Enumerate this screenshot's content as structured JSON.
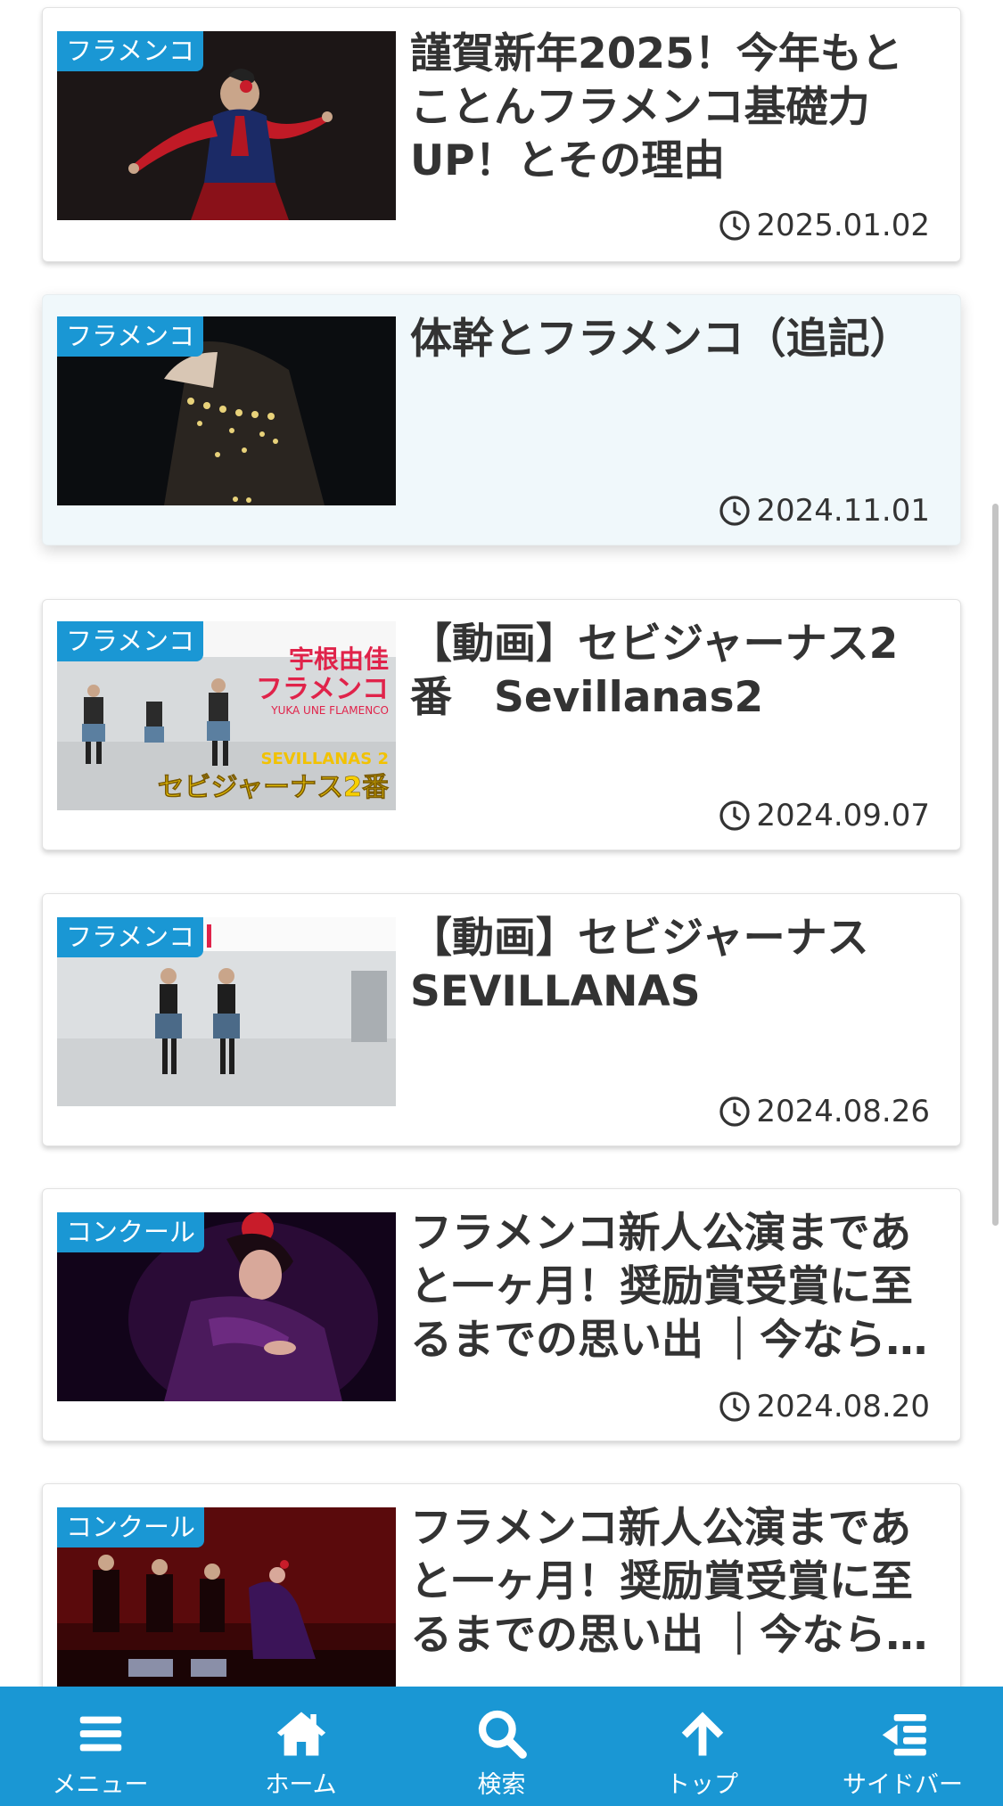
{
  "articles": [
    {
      "category": "フラメンコ",
      "title": "謹賀新年2025！今年もとことんフラメンコ基礎力UP！とその理由",
      "date": "2025.01.02"
    },
    {
      "category": "フラメンコ",
      "title": "体幹とフラメンコ（追記）",
      "date": "2024.11.01"
    },
    {
      "category": "フラメンコ",
      "title": "【動画】セビジャーナス2番　Sevillanas2",
      "date": "2024.09.07",
      "thumb_text": {
        "name_line1": "宇根由佳",
        "name_line2": "フラメンコ",
        "subtitle": "YUKA UNE FLAMENCO",
        "label_en": "SEVILLANAS 2",
        "label_jp": "セビジャーナス2番"
      }
    },
    {
      "category": "フラメンコ",
      "title": "【動画】セビジャーナスSEVILLANAS",
      "date": "2024.08.26"
    },
    {
      "category": "コンクール",
      "title": "フラメンコ新人公演まであと一ヶ月！奨励賞受賞に至るまでの思い出 ｜今なら…",
      "date": "2024.08.20"
    },
    {
      "category": "コンクール",
      "title": "フラメンコ新人公演まであと一ヶ月！奨励賞受賞に至るまでの思い出 ｜今なら…",
      "date": ""
    }
  ],
  "bottom_nav": [
    {
      "label": "メニュー",
      "icon": "menu-icon"
    },
    {
      "label": "ホーム",
      "icon": "home-icon"
    },
    {
      "label": "検索",
      "icon": "search-icon"
    },
    {
      "label": "トップ",
      "icon": "arrow-up-icon"
    },
    {
      "label": "サイドバー",
      "icon": "sidebar-icon"
    }
  ],
  "colors": {
    "accent": "#1a97d4",
    "hover_card": "#f0f8fb",
    "text": "#333333"
  }
}
